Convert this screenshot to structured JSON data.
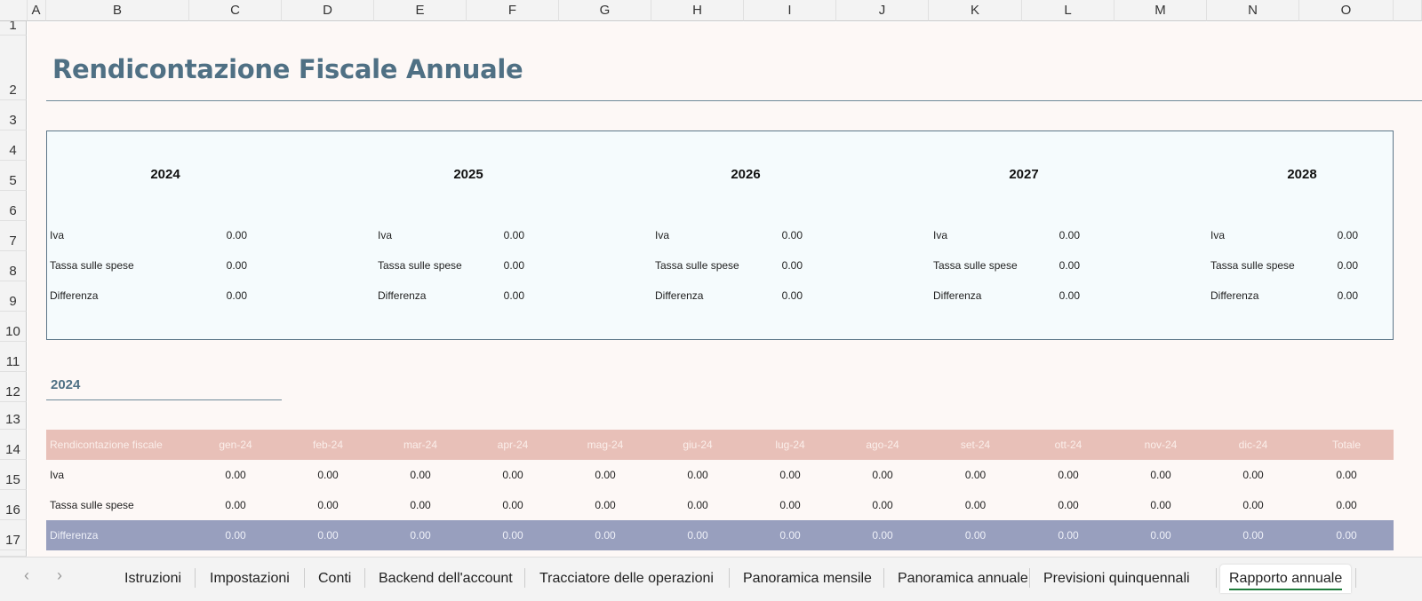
{
  "columns": [
    "A",
    "B",
    "C",
    "D",
    "E",
    "F",
    "G",
    "H",
    "I",
    "J",
    "K",
    "L",
    "M",
    "N",
    "O"
  ],
  "rows": [
    "1",
    "2",
    "3",
    "4",
    "5",
    "6",
    "7",
    "8",
    "9",
    "10",
    "11",
    "12",
    "13",
    "14",
    "15",
    "16",
    "17"
  ],
  "title": "Rendicontazione Fiscale Annuale",
  "summary": [
    {
      "year": "2024",
      "items": [
        {
          "label": "Iva",
          "value": "0.00"
        },
        {
          "label": "Tassa sulle spese",
          "value": "0.00"
        },
        {
          "label": "Differenza",
          "value": "0.00"
        }
      ]
    },
    {
      "year": "2025",
      "items": [
        {
          "label": "Iva",
          "value": "0.00"
        },
        {
          "label": "Tassa sulle spese",
          "value": "0.00"
        },
        {
          "label": "Differenza",
          "value": "0.00"
        }
      ]
    },
    {
      "year": "2026",
      "items": [
        {
          "label": "Iva",
          "value": "0.00"
        },
        {
          "label": "Tassa sulle spese",
          "value": "0.00"
        },
        {
          "label": "Differenza",
          "value": "0.00"
        }
      ]
    },
    {
      "year": "2027",
      "items": [
        {
          "label": "Iva",
          "value": "0.00"
        },
        {
          "label": "Tassa sulle spese",
          "value": "0.00"
        },
        {
          "label": "Differenza",
          "value": "0.00"
        }
      ]
    },
    {
      "year": "2028",
      "items": [
        {
          "label": "Iva",
          "value": "0.00"
        },
        {
          "label": "Tassa sulle spese",
          "value": "0.00"
        },
        {
          "label": "Differenza",
          "value": "0.00"
        }
      ]
    }
  ],
  "section_year": "2024",
  "table": {
    "header": [
      "Rendicontazione fiscale",
      "gen-24",
      "feb-24",
      "mar-24",
      "apr-24",
      "mag-24",
      "giu-24",
      "lug-24",
      "ago-24",
      "set-24",
      "ott-24",
      "nov-24",
      "dic-24",
      "Totale"
    ],
    "rows": [
      [
        "Iva",
        "0.00",
        "0.00",
        "0.00",
        "0.00",
        "0.00",
        "0.00",
        "0.00",
        "0.00",
        "0.00",
        "0.00",
        "0.00",
        "0.00",
        "0.00"
      ],
      [
        "Tassa sulle spese",
        "0.00",
        "0.00",
        "0.00",
        "0.00",
        "0.00",
        "0.00",
        "0.00",
        "0.00",
        "0.00",
        "0.00",
        "0.00",
        "0.00",
        "0.00"
      ],
      [
        "Differenza",
        "0.00",
        "0.00",
        "0.00",
        "0.00",
        "0.00",
        "0.00",
        "0.00",
        "0.00",
        "0.00",
        "0.00",
        "0.00",
        "0.00",
        "0.00"
      ]
    ]
  },
  "sheet_tabs": [
    "Istruzioni",
    "Impostazioni",
    "Conti",
    "Backend dell'account",
    "Tracciatore delle operazioni",
    "Panoramica mensile",
    "Panoramica annuale",
    "Previsioni quinquennali",
    "Rapporto annuale"
  ],
  "active_tab": "Rapporto annuale",
  "colors": {
    "title": "#4f7084",
    "header_row": "#e8c0b8",
    "diff_row": "#989fbe",
    "summary_bg": "#f5fbfd",
    "sheet_bg": "#fdf8f6",
    "active_tab_underline": "#1e7b3c"
  }
}
